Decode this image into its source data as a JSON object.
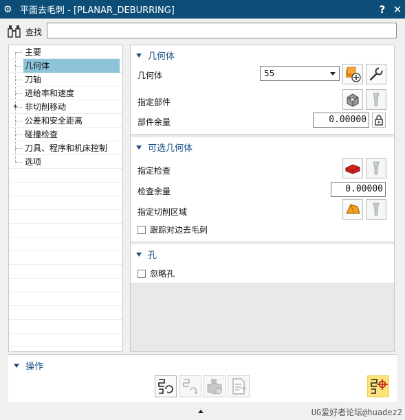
{
  "window": {
    "title": "平面去毛刺 - [PLANAR_DEBURRING]",
    "help_glyph": "?",
    "close_glyph": "✕"
  },
  "search": {
    "label": "查找",
    "value": ""
  },
  "tree": {
    "items": [
      {
        "label": "主要",
        "expandable": false,
        "selected": false
      },
      {
        "label": "几何体",
        "expandable": false,
        "selected": true
      },
      {
        "label": "刀轴",
        "expandable": false,
        "selected": false
      },
      {
        "label": "进给率和速度",
        "expandable": false,
        "selected": false
      },
      {
        "label": "非切削移动",
        "expandable": true,
        "selected": false
      },
      {
        "label": "公差和安全距离",
        "expandable": false,
        "selected": false
      },
      {
        "label": "碰撞检查",
        "expandable": false,
        "selected": false
      },
      {
        "label": "刀具、程序和机床控制",
        "expandable": false,
        "selected": false
      },
      {
        "label": "选项",
        "expandable": false,
        "selected": false
      }
    ]
  },
  "geometry_section": {
    "header": "几何体",
    "geometry_label": "几何体",
    "geometry_value": "55",
    "part_label": "指定部件",
    "part_stock_label": "部件余量",
    "part_stock_value": "0.00000"
  },
  "optional_section": {
    "header": "可选几何体",
    "check_label": "指定检查",
    "check_stock_label": "检查余量",
    "check_stock_value": "0.00000",
    "cut_area_label": "指定切削区域",
    "track_edge_label": "跟踪对边去毛刺",
    "track_edge_checked": false
  },
  "hole_section": {
    "header": "孔",
    "ignore_hole_label": "忽略孔",
    "ignore_hole_checked": false
  },
  "actions_section": {
    "header": "操作"
  },
  "footer": {
    "watermark": "UG爱好者论坛@huadez2"
  },
  "colors": {
    "titlebar": "#0c4e78",
    "section_header": "#1a4f86",
    "tree_selected": "#8ec4d9",
    "generate_highlight": "#fbe27a"
  }
}
